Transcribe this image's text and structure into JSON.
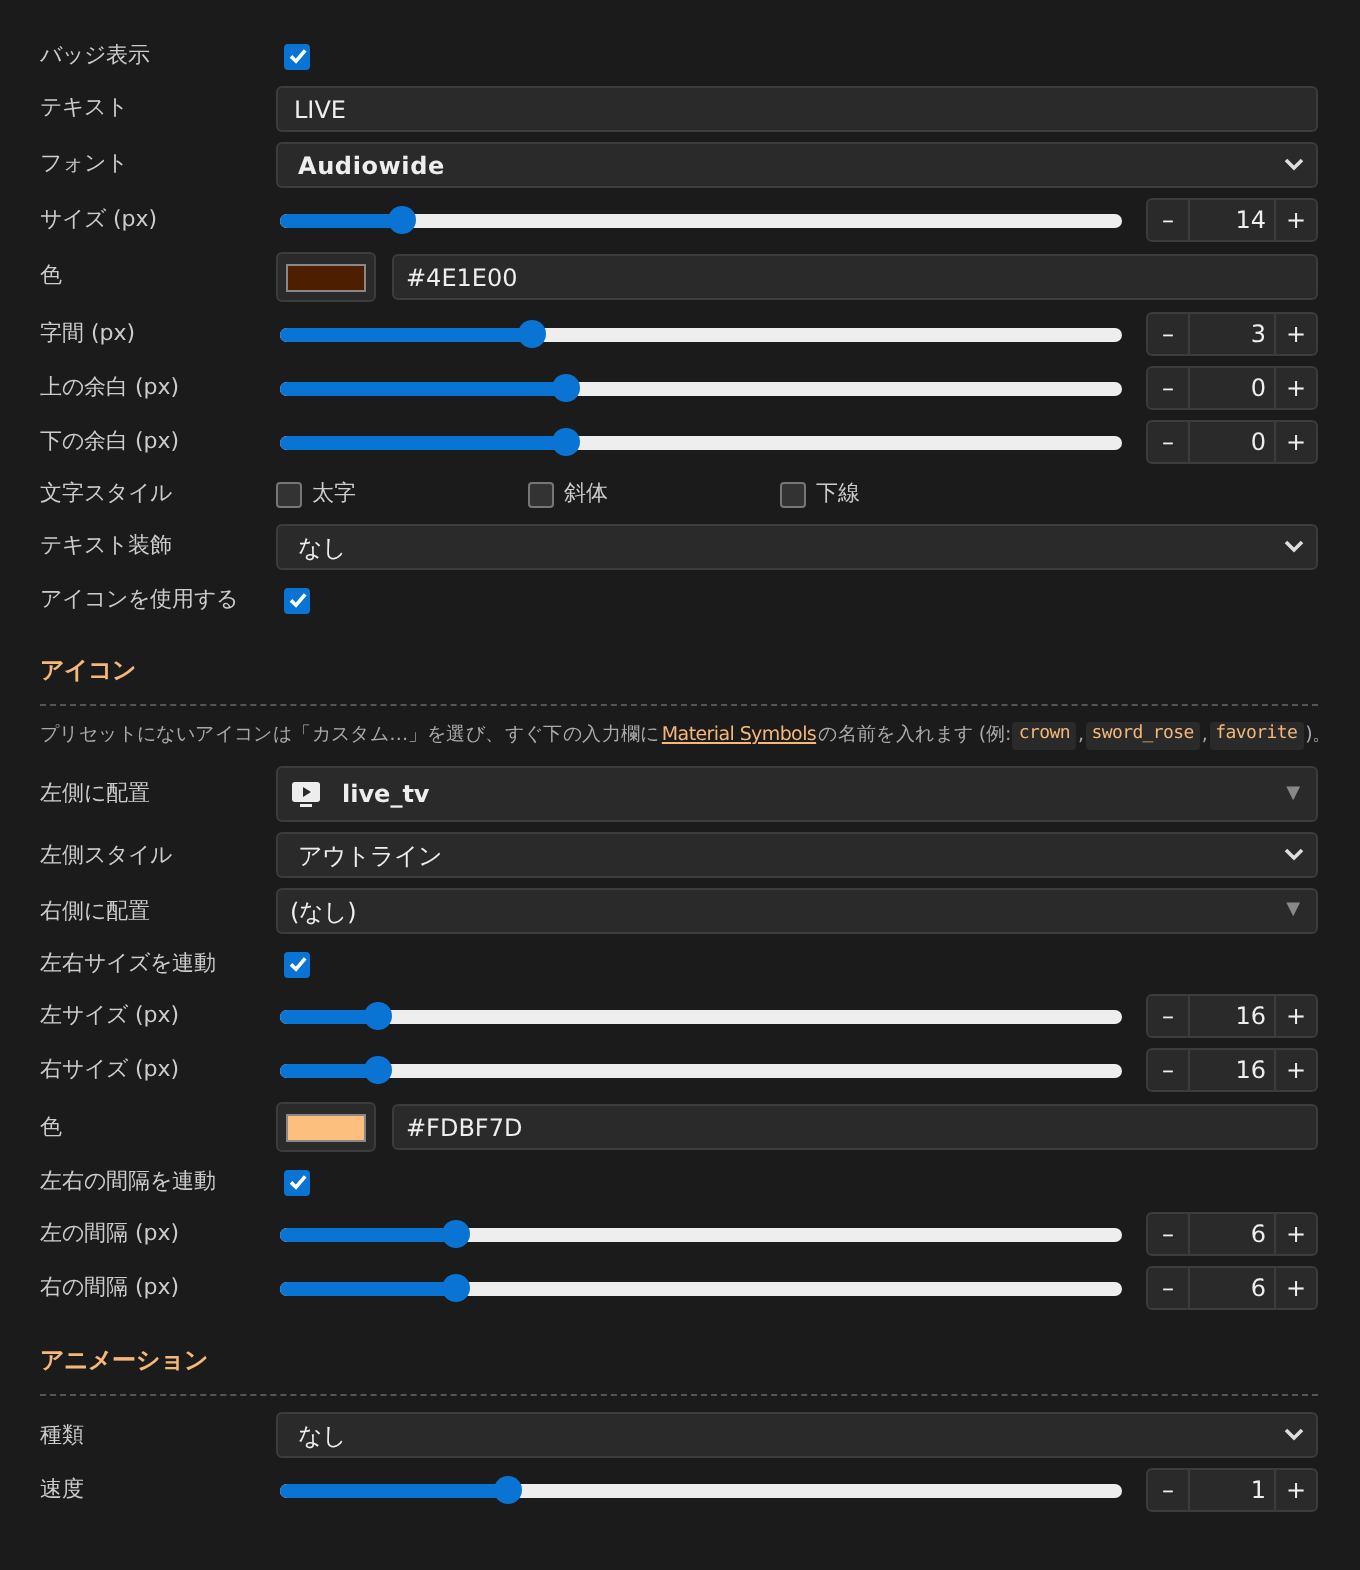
{
  "sections": [
    {
      "rows": [
        {
          "kind": "checkbox",
          "label": "バッジ表示",
          "checked": true
        },
        {
          "kind": "text",
          "label": "テキスト",
          "value": "LIVE"
        },
        {
          "kind": "select",
          "label": "フォント",
          "value": "Audiowide"
        },
        {
          "kind": "slider",
          "label": "サイズ (px)",
          "level": 0.145,
          "value": "14",
          "minus": "–",
          "plus": "+"
        },
        {
          "kind": "color",
          "label": "色",
          "color": "#4e1e00",
          "value": "#4E1E00"
        },
        {
          "kind": "slider",
          "label": "字間 (px)",
          "level": 0.3,
          "value": "3",
          "minus": "–",
          "plus": "+"
        },
        {
          "kind": "slider",
          "label": "上の余白 (px)",
          "level": 0.34,
          "value": "0",
          "minus": "–",
          "plus": "+"
        },
        {
          "kind": "slider",
          "label": "下の余白 (px)",
          "level": 0.34,
          "value": "0",
          "minus": "–",
          "plus": "+"
        },
        {
          "kind": "checkgroup",
          "label": "文字スタイル",
          "options": [
            {
              "label": "太字",
              "checked": false
            },
            {
              "label": "斜体",
              "checked": false
            },
            {
              "label": "下線",
              "checked": false
            }
          ]
        },
        {
          "kind": "select",
          "label": "テキスト装飾",
          "value": "なし"
        },
        {
          "kind": "checkbox",
          "label": "アイコンを使用する",
          "checked": true
        }
      ]
    },
    {
      "heading": "アイコン",
      "description": [
        {
          "kind": "text",
          "text": "プリセットにないアイコンは「カスタム…」を選び、すぐ下の入力欄に"
        },
        {
          "kind": "link",
          "text": "Material Symbols"
        },
        {
          "kind": "text",
          "text": "の名前を入れます (例:"
        },
        {
          "kind": "code",
          "text": "crown"
        },
        {
          "kind": "text",
          "text": ","
        },
        {
          "kind": "code",
          "text": "sword_rose"
        },
        {
          "kind": "text",
          "text": ","
        },
        {
          "kind": "code",
          "text": "favorite"
        },
        {
          "kind": "text",
          "text": ")。"
        }
      ],
      "rows": [
        {
          "kind": "iconselect",
          "label": "左側に配置",
          "value": "live_tv",
          "arrow": "▼"
        },
        {
          "kind": "select",
          "label": "左側スタイル",
          "value": "アウトライン"
        },
        {
          "kind": "combo",
          "label": "右側に配置",
          "value": "(なし)",
          "arrow": "▼"
        },
        {
          "kind": "checkbox",
          "label": "左右サイズを連動",
          "checked": true
        },
        {
          "kind": "slider",
          "label": "左サイズ (px)",
          "level": 0.116,
          "value": "16",
          "minus": "–",
          "plus": "+"
        },
        {
          "kind": "slider",
          "label": "右サイズ (px)",
          "level": 0.116,
          "value": "16",
          "minus": "–",
          "plus": "+"
        },
        {
          "kind": "color",
          "label": "色",
          "color": "#fdbf7d",
          "value": "#FDBF7D"
        },
        {
          "kind": "checkbox",
          "label": "左右の間隔を連動",
          "checked": true
        },
        {
          "kind": "slider",
          "label": "左の間隔 (px)",
          "level": 0.21,
          "value": "6",
          "minus": "–",
          "plus": "+"
        },
        {
          "kind": "slider",
          "label": "右の間隔 (px)",
          "level": 0.21,
          "value": "6",
          "minus": "–",
          "plus": "+"
        }
      ]
    },
    {
      "heading": "アニメーション",
      "rows": [
        {
          "kind": "select",
          "label": "種類",
          "value": "なし"
        },
        {
          "kind": "slider",
          "label": "速度",
          "level": 0.27,
          "value": "1",
          "minus": "–",
          "plus": "+"
        }
      ]
    }
  ]
}
